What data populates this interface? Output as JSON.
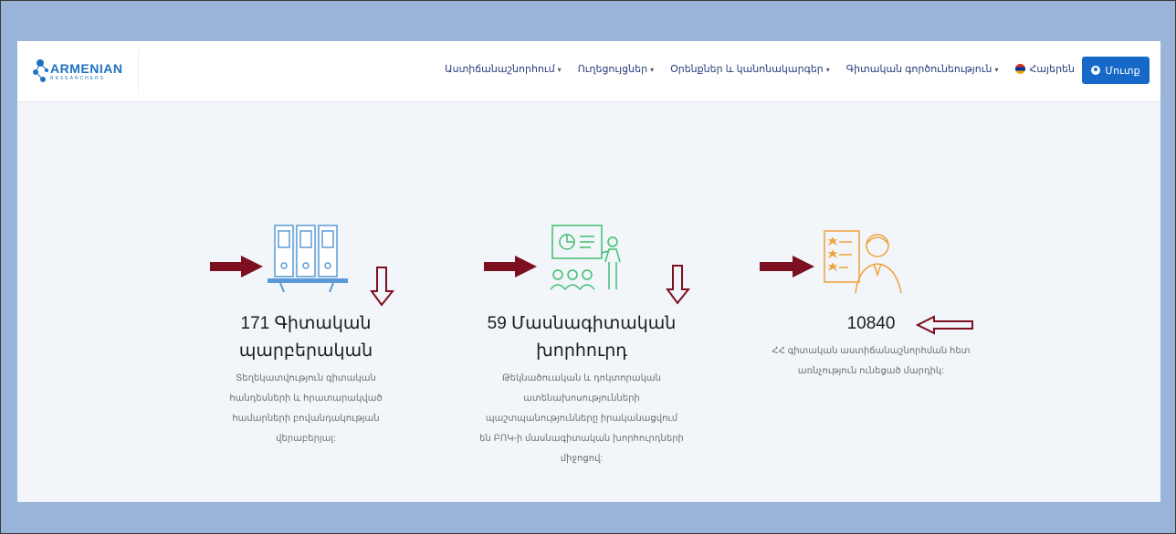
{
  "logo": {
    "word": "ARMENIAN",
    "sub": "RESEARCHERS"
  },
  "nav": {
    "items": [
      "Աստիճանաշնորհում",
      "Ուղեցույցներ",
      "Օրենքներ և կանոնակարգեր",
      "Գիտական գործունեություն"
    ],
    "language": "Հայերեն",
    "login": "Մուտք"
  },
  "stats": [
    {
      "number": "171 Գիտական պարբերական",
      "description": "Տեղեկատվություն գիտական հանդեսների և հրատարակված համարների բովանդակության վերաբերյալ:",
      "icon": "bookshelf-icon"
    },
    {
      "number": "59 Մասնագիտական խորհուրդ",
      "description": "Թեկնածուական և դոկտորական ատենախոսությունների պաշտպանությունները իրականացվում են ԲՈԿ-ի մասնագիտական խորհուրդների միջոցով:",
      "icon": "presentation-icon"
    },
    {
      "number": "10840",
      "description": "ՀՀ գիտական աստիճանաշնորհման հետ առնչություն ունեցած մարդիկ:",
      "icon": "researcher-icon"
    }
  ],
  "colors": {
    "accent": "#1769c8",
    "annotation": "#7d1020",
    "icon_blue": "#5b9bd5",
    "icon_green": "#3fbf6f",
    "icon_orange": "#f0a23a"
  }
}
